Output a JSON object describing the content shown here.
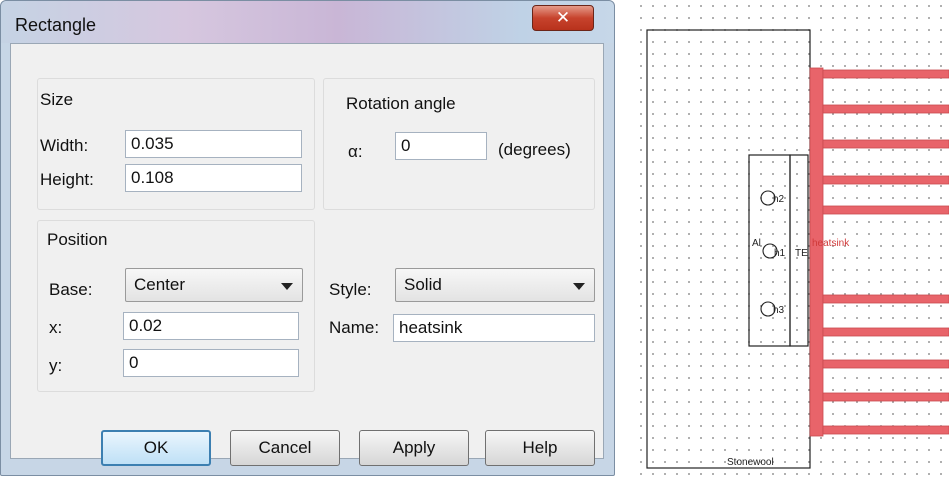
{
  "dialog": {
    "title": "Rectangle",
    "close_icon": "close-x-icon",
    "size": {
      "label": "Size",
      "width_label": "Width:",
      "width_value": "0.035",
      "height_label": "Height:",
      "height_value": "0.108"
    },
    "rotation": {
      "label": "Rotation angle",
      "alpha_label": "α:",
      "alpha_value": "0",
      "unit": "(degrees)"
    },
    "position": {
      "label": "Position",
      "base_label": "Base:",
      "base_value": "Center",
      "x_label": "x:",
      "x_value": "0.02",
      "y_label": "y:",
      "y_value": "0"
    },
    "style": {
      "style_label": "Style:",
      "style_value": "Solid",
      "name_label": "Name:",
      "name_value": "heatsink"
    },
    "buttons": {
      "ok": "OK",
      "cancel": "Cancel",
      "apply": "Apply",
      "help": "Help"
    }
  },
  "canvas": {
    "labels": {
      "h2": "h2",
      "h1": "h1",
      "h3": "h3",
      "al": "Al",
      "te": "TE",
      "heatsink": "heatsink",
      "stonewool": "Stonewool"
    },
    "colors": {
      "heatsink": "#e8646a",
      "heatsink_label": "#d03a3a",
      "outline": "#222222"
    }
  }
}
